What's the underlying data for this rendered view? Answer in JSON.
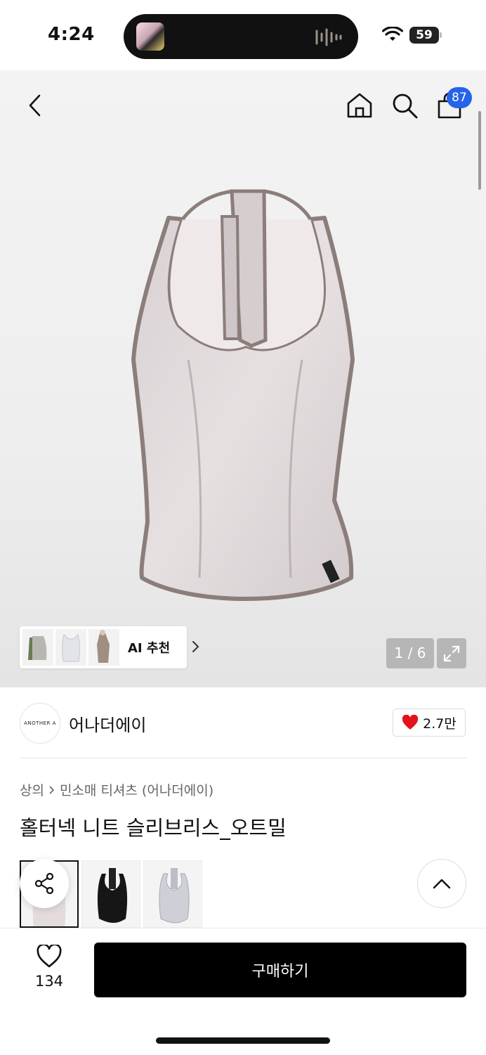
{
  "status_bar": {
    "time": "4:24",
    "battery": "59"
  },
  "top_nav": {
    "back_icon": "chevron-left-icon",
    "home_icon": "home-icon",
    "search_icon": "search-icon",
    "cart_icon": "shopping-bag-icon",
    "cart_count": "87"
  },
  "gallery": {
    "page_indicator": "1 / 6",
    "ai_label": "AI 추천"
  },
  "brand": {
    "logo_text": "ANOTHER A",
    "name": "어나더에이",
    "like_count": "2.7만"
  },
  "product": {
    "breadcrumb": [
      "상의",
      "민소매 티셔츠 (어나더에이)"
    ],
    "title": "홀터넥 니트 슬리브리스_오트밀"
  },
  "color_options": [
    "oatmeal",
    "black",
    "light-gray"
  ],
  "bottom_bar": {
    "wish_count": "134",
    "buy_label": "구매하기"
  },
  "colors": {
    "badge": "#2563eb",
    "buy_button": "#000000",
    "heart": "#e3121b"
  }
}
